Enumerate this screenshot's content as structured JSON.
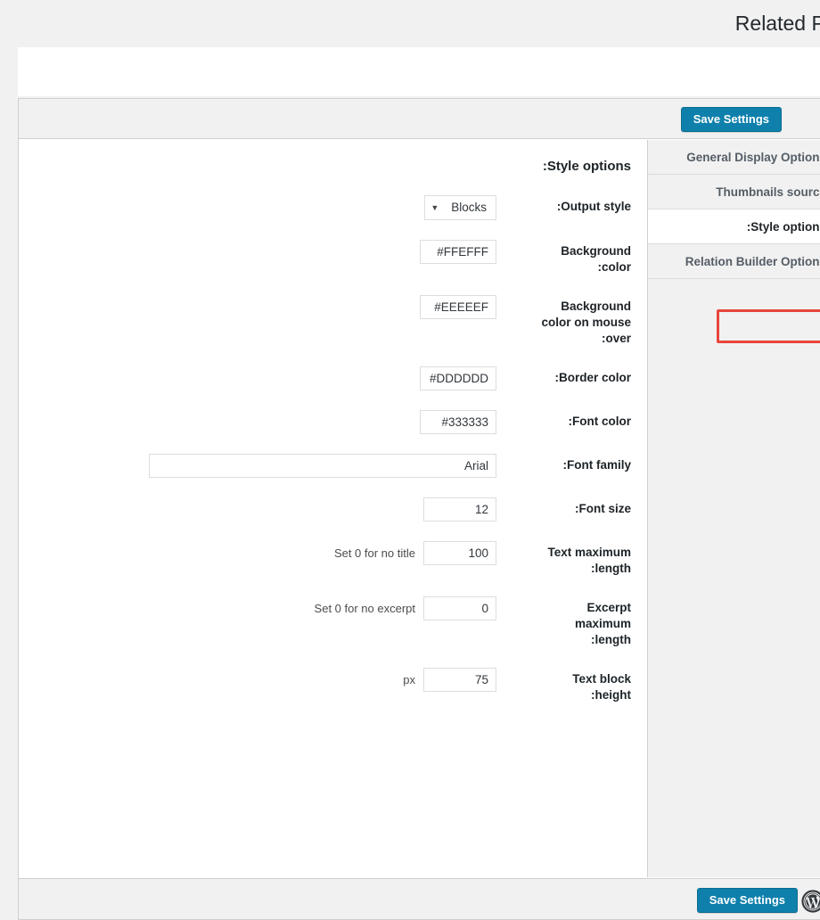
{
  "page": {
    "heading": "Related Posts",
    "heading_visible": "Related P"
  },
  "toolbar": {
    "save_label": "Save Settings",
    "wp_logo_icon": "wordpress-logo-icon"
  },
  "tabs": [
    {
      "label": "General Display Options",
      "active": false
    },
    {
      "label": "Thumbnails source",
      "active": false
    },
    {
      "label": ":Style options",
      "active": true
    },
    {
      "label": "Relation Builder Options",
      "active": false
    }
  ],
  "highlight_color": "#e8453c",
  "accent_color": "#0e80ab",
  "section": {
    "title": ":Style options"
  },
  "fields": [
    {
      "name": "output-style",
      "label": ":Output style",
      "control": "select",
      "value": "Blocks",
      "arrow": "▼"
    },
    {
      "name": "background-color",
      "label": "Background :color",
      "label_line1": "Background",
      "label_line2": ":color",
      "control": "text",
      "value": "FFEFFF#"
    },
    {
      "name": "background-color-hover",
      "label_line1": "Background",
      "label_line2": "color on mouse",
      "label_line3": ":over",
      "control": "text",
      "value": "EEEEEF#"
    },
    {
      "name": "border-color",
      "label": ":Border color",
      "control": "text",
      "value": "DDDDDD#"
    },
    {
      "name": "font-color",
      "label": ":Font color",
      "control": "text",
      "value": "#333333"
    },
    {
      "name": "font-family",
      "label": ":Font family",
      "control": "text-wide",
      "value": "Arial"
    },
    {
      "name": "font-size",
      "label": ":Font size",
      "control": "text",
      "value": "12"
    },
    {
      "name": "text-maximum-length",
      "label_line1": "Text maximum",
      "label_line2": ":length",
      "control": "text",
      "value": "100",
      "hint": "Set 0 for no title"
    },
    {
      "name": "excerpt-maximum-length",
      "label_line1": "Excerpt",
      "label_line2": "maximum",
      "label_line3": ":length",
      "control": "text",
      "value": "0",
      "hint": "Set 0 for no excerpt"
    },
    {
      "name": "text-block-height",
      "label_line1": "Text block",
      "label_line2": ":height",
      "control": "text",
      "value": "75",
      "unit": "px"
    }
  ]
}
